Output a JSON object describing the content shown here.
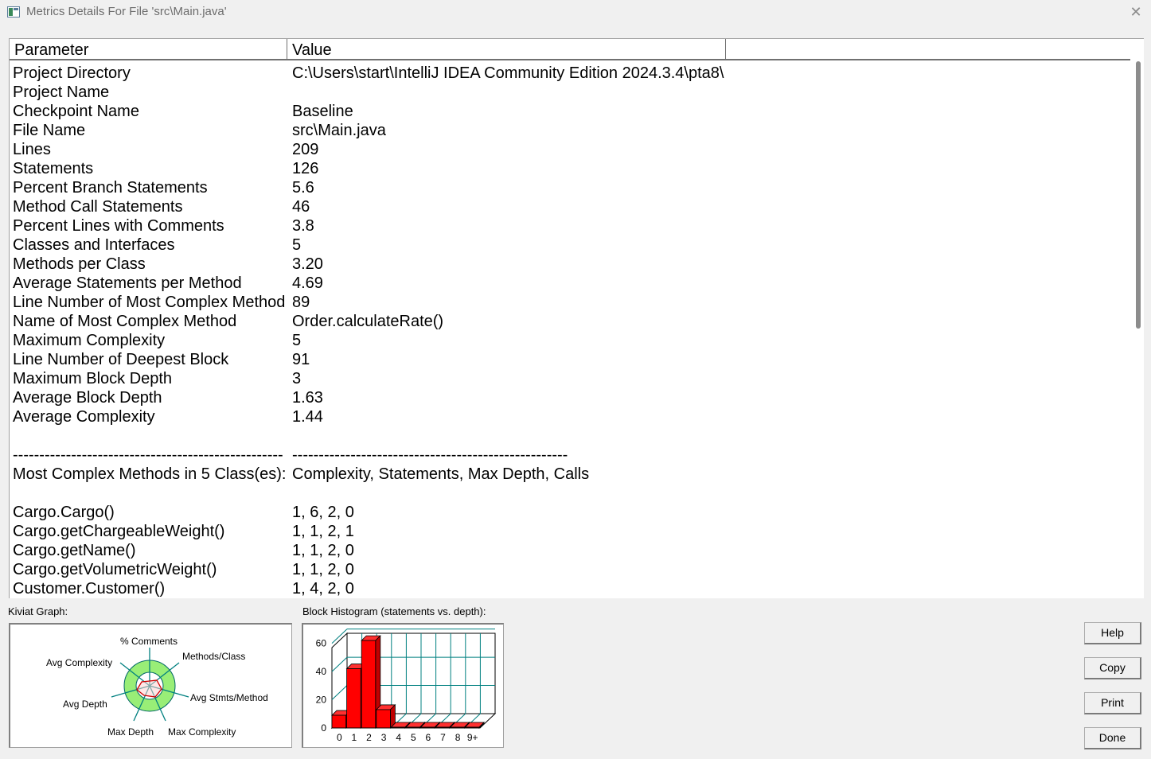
{
  "window": {
    "title": "Metrics Details For File 'src\\Main.java'",
    "close_glyph": "✕"
  },
  "table": {
    "headers": {
      "parameter": "Parameter",
      "value": "Value"
    },
    "rows": [
      {
        "p": "Project Directory",
        "v": "C:\\Users\\start\\IntelliJ IDEA Community Edition 2024.3.4\\pta8\\"
      },
      {
        "p": "Project Name",
        "v": ""
      },
      {
        "p": "Checkpoint Name",
        "v": "Baseline"
      },
      {
        "p": "File Name",
        "v": "src\\Main.java"
      },
      {
        "p": "Lines",
        "v": "209"
      },
      {
        "p": "Statements",
        "v": "126"
      },
      {
        "p": "Percent Branch Statements",
        "v": "5.6"
      },
      {
        "p": "Method Call Statements",
        "v": "46"
      },
      {
        "p": "Percent Lines with Comments",
        "v": "3.8"
      },
      {
        "p": "Classes and Interfaces",
        "v": "5"
      },
      {
        "p": "Methods per Class",
        "v": "3.20"
      },
      {
        "p": "Average Statements per Method",
        "v": "4.69"
      },
      {
        "p": "Line Number of Most Complex Method",
        "v": "89"
      },
      {
        "p": "Name of Most Complex Method",
        "v": "Order.calculateRate()"
      },
      {
        "p": "Maximum Complexity",
        "v": "5"
      },
      {
        "p": "Line Number of Deepest Block",
        "v": "91"
      },
      {
        "p": "Maximum Block Depth",
        "v": "3"
      },
      {
        "p": "Average Block Depth",
        "v": "1.63"
      },
      {
        "p": "Average Complexity",
        "v": "1.44"
      },
      {
        "p": "",
        "v": ""
      },
      {
        "p": "---------------------------------------------------",
        "v": "----------------------------------------------------"
      },
      {
        "p": "Most Complex Methods in 5 Class(es):",
        "v": "Complexity, Statements, Max Depth, Calls"
      },
      {
        "p": "",
        "v": ""
      },
      {
        "p": "Cargo.Cargo()",
        "v": "1, 6, 2, 0"
      },
      {
        "p": "Cargo.getChargeableWeight()",
        "v": "1, 1, 2, 1"
      },
      {
        "p": "Cargo.getName()",
        "v": "1, 1, 2, 0"
      },
      {
        "p": "Cargo.getVolumetricWeight()",
        "v": "1, 1, 2, 0"
      },
      {
        "p": "Customer.Customer()",
        "v": "1, 4, 2, 0"
      }
    ]
  },
  "kiviat": {
    "caption": "Kiviat Graph:",
    "labels": {
      "comments": "% Comments",
      "methods_class": "Methods/Class",
      "avg_stmts": "Avg Stmts/Method",
      "max_complexity": "Max Complexity",
      "max_depth": "Max Depth",
      "avg_depth": "Avg Depth",
      "avg_complexity": "Avg Complexity"
    },
    "colors": {
      "outer_ring": "#99ee77",
      "inner_ring": "#ffffff",
      "spokes": "#008080",
      "plot": "#cc0000"
    }
  },
  "histogram": {
    "caption": "Block Histogram (statements vs. depth):",
    "chart_data": {
      "type": "bar",
      "categories": [
        "0",
        "1",
        "2",
        "3",
        "4",
        "5",
        "6",
        "7",
        "8",
        "9+"
      ],
      "values": [
        9,
        42,
        62,
        13,
        0,
        0,
        0,
        0,
        0,
        0
      ],
      "yticks": [
        "0",
        "20",
        "40",
        "60"
      ],
      "ylim": [
        0,
        66
      ],
      "grid": true,
      "bar_color": "#ff0000"
    }
  },
  "buttons": {
    "help": "Help",
    "copy": "Copy",
    "print": "Print",
    "done": "Done"
  }
}
